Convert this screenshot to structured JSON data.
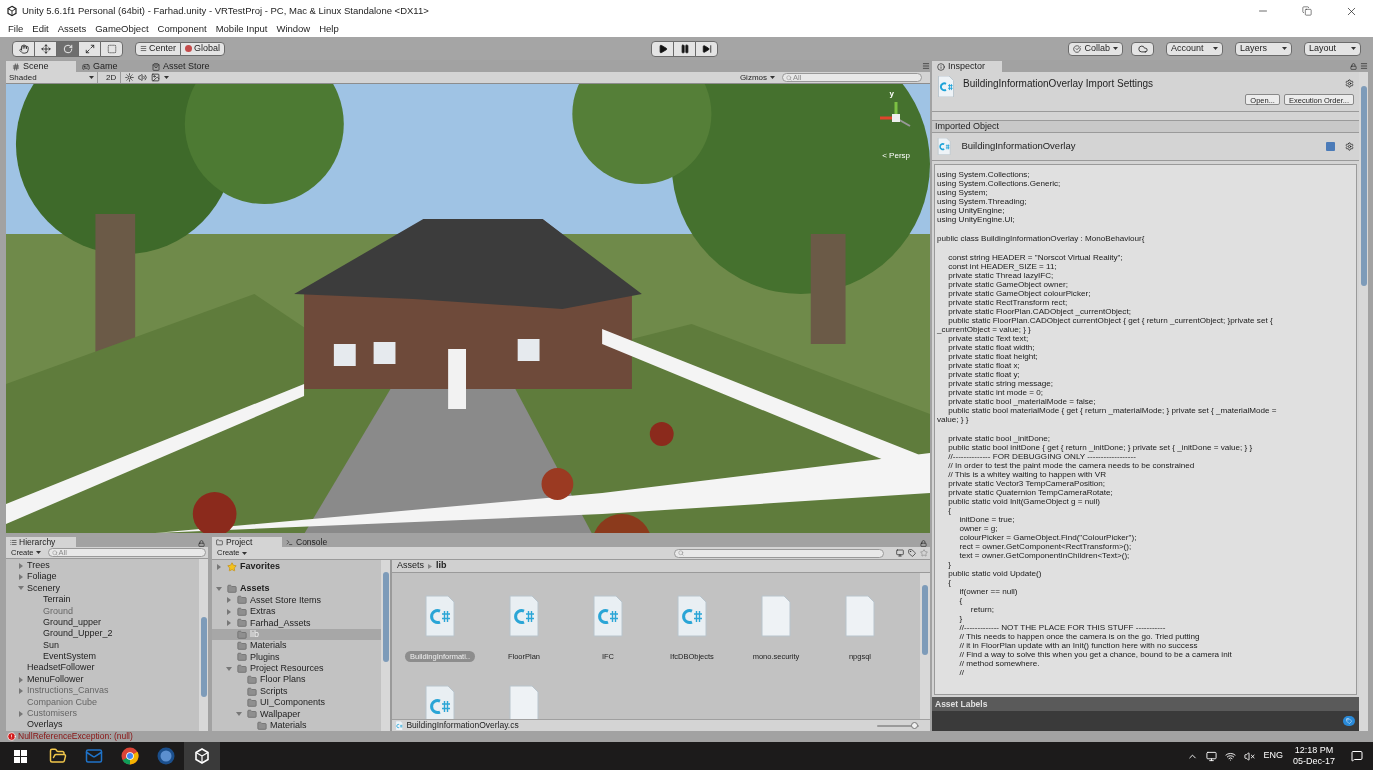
{
  "window": {
    "title": "Unity 5.6.1f1 Personal (64bit) - Farhad.unity - VRTestProj - PC, Mac & Linux Standalone <DX11>"
  },
  "menu": [
    "File",
    "Edit",
    "Assets",
    "GameObject",
    "Component",
    "Mobile Input",
    "Window",
    "Help"
  ],
  "toolbar": {
    "tools": [
      {
        "kind": "hand",
        "selected": false
      },
      {
        "kind": "move",
        "selected": false
      },
      {
        "kind": "rotate",
        "selected": true
      },
      {
        "kind": "scale",
        "selected": false
      },
      {
        "kind": "rect",
        "selected": false
      }
    ],
    "pivot": [
      "Center",
      "Global"
    ],
    "playback": [
      {
        "kind": "play"
      },
      {
        "kind": "pause"
      },
      {
        "kind": "step"
      }
    ],
    "right": [
      {
        "kind": "collab",
        "label": "Collab"
      },
      {
        "kind": "cloud"
      },
      {
        "kind": "dropdown",
        "label": "Account"
      },
      {
        "kind": "dropdown",
        "label": "Layers"
      },
      {
        "kind": "dropdown",
        "label": "Layout"
      }
    ]
  },
  "scene": {
    "tabs": [
      {
        "kind": "scene",
        "label": "Scene",
        "selected": true
      },
      {
        "kind": "game",
        "label": "Game",
        "selected": false
      },
      {
        "kind": "store",
        "label": "Asset Store",
        "selected": false
      }
    ],
    "shading": "Shaded",
    "mode_2d": "2D",
    "gizmos": "Gizmos",
    "search_placeholder": "All",
    "gizmo_axis": "y",
    "view_mode": "< Persp"
  },
  "hierarchy": {
    "tab": "Hierarchy",
    "create": "Create",
    "search_placeholder": "All",
    "items": [
      {
        "name": "Trees",
        "expanded": false,
        "disabled": false
      },
      {
        "name": "Foliage",
        "expanded": false,
        "disabled": false
      },
      {
        "name": "Scenery",
        "expanded": true,
        "disabled": false,
        "children": [
          {
            "name": "Terrain",
            "disabled": false
          },
          {
            "name": "Ground",
            "disabled": true
          },
          {
            "name": "Ground_upper",
            "disabled": false
          },
          {
            "name": "Ground_Upper_2",
            "disabled": false
          },
          {
            "name": "Sun",
            "disabled": false
          },
          {
            "name": "EventSystem",
            "disabled": false
          }
        ]
      },
      {
        "name": "HeadsetFollower",
        "disabled": false
      },
      {
        "name": "MenuFollower",
        "expanded": false,
        "disabled": false
      },
      {
        "name": "Instructions_Canvas",
        "expanded": false,
        "disabled": true
      },
      {
        "name": "Companion Cube",
        "disabled": true
      },
      {
        "name": "Customisers",
        "expanded": false,
        "disabled": true
      },
      {
        "name": "Overlays",
        "disabled": false
      }
    ]
  },
  "project": {
    "tabs": [
      {
        "kind": "project",
        "label": "Project",
        "selected": true
      },
      {
        "kind": "console",
        "label": "Console",
        "selected": false
      }
    ],
    "create": "Create",
    "tree": [
      {
        "name": "Favorites",
        "kind": "favorites",
        "expanded": false,
        "selected": false
      },
      {
        "name": "Assets",
        "kind": "root",
        "expanded": true,
        "selected": false,
        "children": [
          {
            "name": "Asset Store Items",
            "expanded": false,
            "selected": false
          },
          {
            "name": "Extras",
            "expanded": false,
            "selected": false
          },
          {
            "name": "Farhad_Assets",
            "expanded": false,
            "selected": false
          },
          {
            "name": "lib",
            "selected": true
          },
          {
            "name": "Materials",
            "selected": false
          },
          {
            "name": "Plugins",
            "selected": false
          },
          {
            "name": "Project Resources",
            "expanded": true,
            "selected": false,
            "children": [
              {
                "name": "Floor Plans",
                "selected": false
              },
              {
                "name": "Scripts",
                "selected": false
              },
              {
                "name": "UI_Components",
                "selected": false
              },
              {
                "name": "Wallpaper",
                "expanded": true,
                "selected": false,
                "children": [
                  {
                    "name": "Materials",
                    "selected": false
                  }
                ]
              }
            ]
          }
        ]
      }
    ],
    "breadcrumb": [
      "Assets",
      "lib"
    ],
    "assets": [
      {
        "kind": "script",
        "label": "BuildingInformati..",
        "selected": true
      },
      {
        "kind": "script",
        "label": "FloorPlan",
        "selected": false
      },
      {
        "kind": "script",
        "label": "IFC",
        "selected": false
      },
      {
        "kind": "script",
        "label": "IfcDBObjects",
        "selected": false
      },
      {
        "kind": "file",
        "label": "mono.security",
        "selected": false
      },
      {
        "kind": "file",
        "label": "npgsql",
        "selected": false
      },
      {
        "kind": "script"
      },
      {
        "kind": "file"
      }
    ],
    "selected_path": "BuildingInformationOverlay.cs",
    "zoom": {
      "level": 0.9
    }
  },
  "inspector": {
    "tab": "Inspector",
    "title": "BuildingInformationOverlay Import Settings",
    "buttons": [
      "Open...",
      "Execution Order..."
    ],
    "section": "Imported Object",
    "object_name": "BuildingInformationOverlay",
    "code_blocks": [
      [
        "using System.Collections;",
        "using System.Collections.Generic;",
        "using System;",
        "using System.Threading;",
        "using UnityEngine;",
        "using UnityEngine.UI;"
      ],
      [
        "public class BuildingInformationOverlay : MonoBehaviour{"
      ],
      [
        "     const string HEADER = \"Norscot Virtual Reality\";",
        "     const int HEADER_SIZE = 11;",
        "     private static Thread lazyIFC;",
        "     private static GameObject owner;",
        "     private static GameObject colourPicker;",
        "     private static RectTransform rect;",
        "     private static FloorPlan.CADObject _currentObject;",
        "     public static FloorPlan.CADObject currentObject { get { return _currentObject; }private set {",
        "_currentObject = value; } }",
        "     private static Text text;",
        "     private static float width;",
        "     private static float height;",
        "     private static float x;",
        "     private static float y;",
        "     private static string message;",
        "     private static int mode = 0;",
        "     private static bool _materialMode = false;",
        "     public static bool materialMode { get { return _materialMode; } private set { _materialMode =",
        "value; } }"
      ],
      [
        "     private static bool _initDone;",
        "     public static bool initDone { get { return _initDone; } private set { _initDone = value; } }",
        "     //-------------- FOR DEBUGGING ONLY ------------------",
        "     // In order to test the paint mode the camera needs to be constrained",
        "     // This is a whitey waiting to happen with VR",
        "     private static Vector3 TempCameraPosition;",
        "     private static Quaternion TempCameraRotate;",
        "     public static void Init(GameObject g = null)",
        "     {",
        "          initDone = true;",
        "          owner = g;",
        "          colourPicker = GameObject.Find(\"ColourPicker\");",
        "          rect = owner.GetComponent<RectTransform>();",
        "          text = owner.GetComponentInChildren<Text>();",
        "     }",
        "     public static void Update()",
        "     {",
        "          if(owner == null)",
        "          {",
        "               return;",
        "          }",
        "          //------------- NOT THE PLACE FOR THIS STUFF -----------",
        "          // This needs to happen once the camera is on the go. Tried putting",
        "          // it in FloorPlan update with an Init() function here with no success",
        "          // Find a way to solve this when you get a chance, bound to be a camera init",
        "          // method somewhere.",
        "          //"
      ]
    ],
    "labels_title": "Asset Labels"
  },
  "status": {
    "kind": "error",
    "message": "NullReferenceException: (null)"
  },
  "taskbar": {
    "apps": [
      {
        "kind": "explorer",
        "selected": false
      },
      {
        "kind": "mail",
        "selected": false
      },
      {
        "kind": "browser",
        "selected": false
      },
      {
        "kind": "vr",
        "selected": false
      },
      {
        "kind": "unity",
        "selected": true
      }
    ],
    "language": "ENG",
    "time": "12:18 PM",
    "date": "05-Dec-17"
  }
}
